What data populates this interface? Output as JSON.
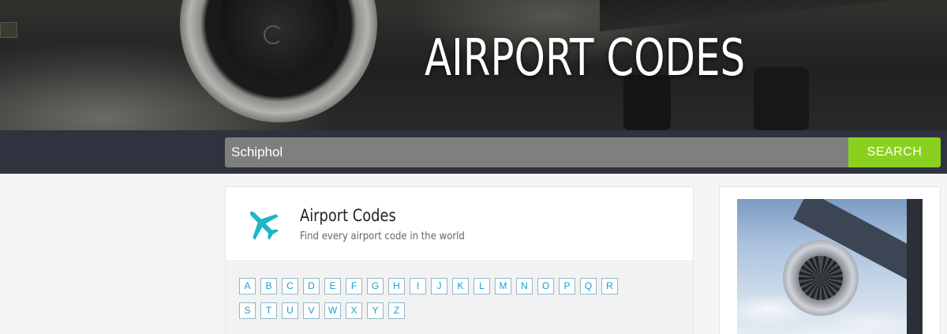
{
  "hero": {
    "title": "AIRPORT CODES"
  },
  "search": {
    "value": "Schiphol",
    "button_label": "SEARCH"
  },
  "card": {
    "title": "Airport Codes",
    "subtitle": "Find every airport code in the world",
    "icon": "airplane-icon",
    "icon_color": "#1fb5c4",
    "letters": [
      "A",
      "B",
      "C",
      "D",
      "E",
      "F",
      "G",
      "H",
      "I",
      "J",
      "K",
      "L",
      "M",
      "N",
      "O",
      "P",
      "Q",
      "R",
      "S",
      "T",
      "U",
      "V",
      "W",
      "X",
      "Y",
      "Z"
    ]
  },
  "colors": {
    "search_band": "#2f3340",
    "search_button": "#8ad11f",
    "link": "#1a9fc8"
  }
}
